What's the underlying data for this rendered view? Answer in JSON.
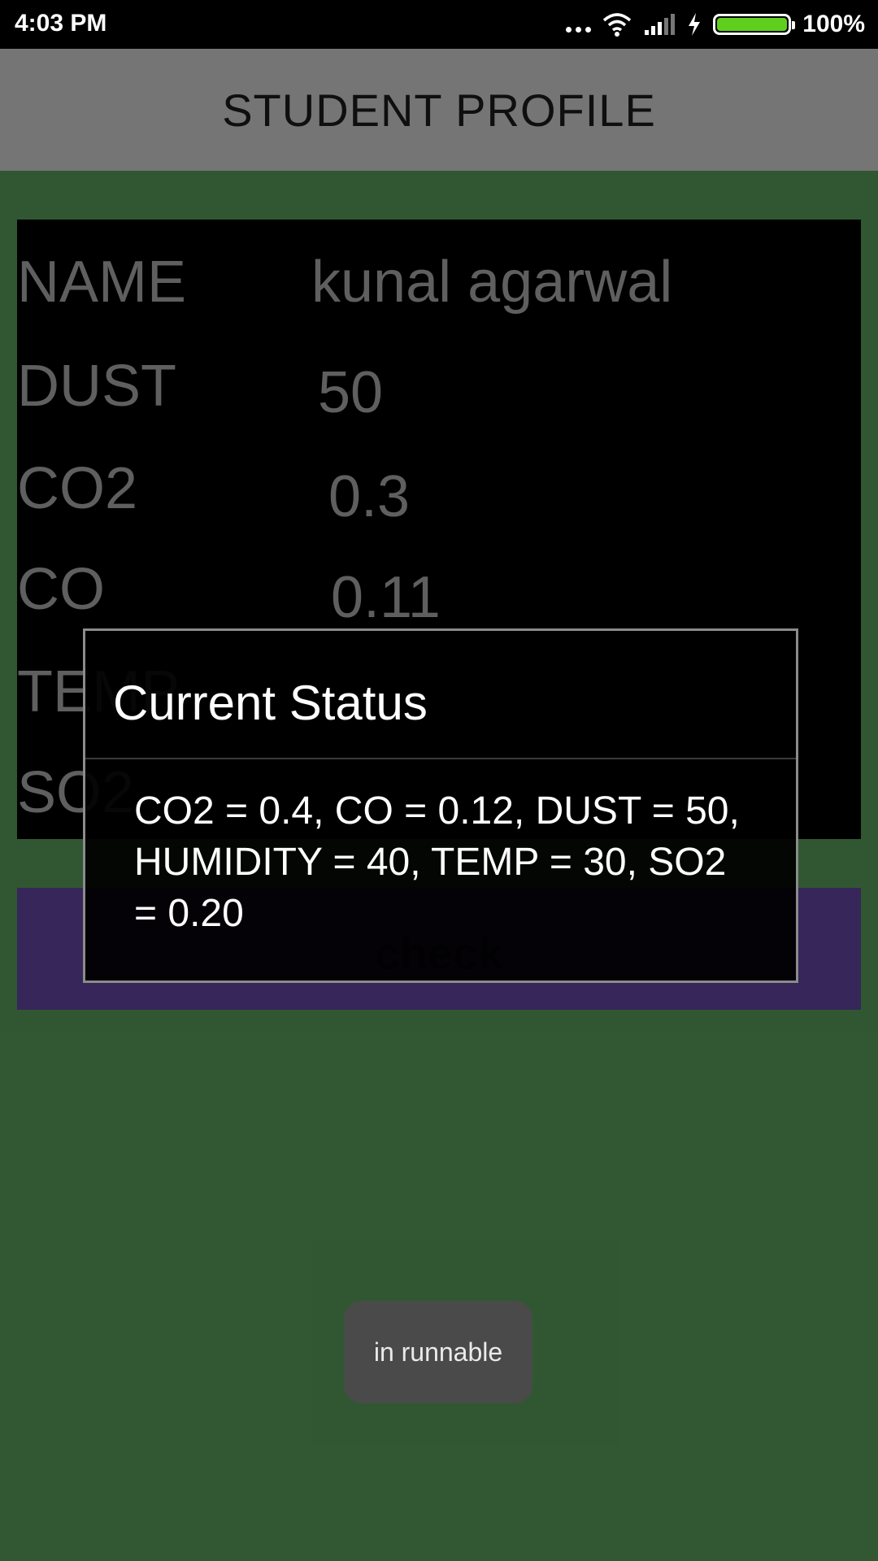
{
  "status_bar": {
    "time": "4:03 PM",
    "battery_percent": "100%",
    "icons": [
      "more-dots-icon",
      "wifi-icon",
      "signal-icon",
      "charging-icon",
      "battery-icon"
    ]
  },
  "app_bar": {
    "title": "STUDENT PROFILE"
  },
  "profile": {
    "rows": [
      {
        "label": "NAME",
        "value": "kunal agarwal"
      },
      {
        "label": "DUST",
        "value": "50"
      },
      {
        "label": "CO2",
        "value": "0.3"
      },
      {
        "label": "CO",
        "value": "0.11"
      },
      {
        "label": "TEMP",
        "value": ""
      },
      {
        "label": "SO2",
        "value": ""
      }
    ]
  },
  "check_button": {
    "label": "check"
  },
  "dialog": {
    "title": "Current Status",
    "message": "CO2 = 0.4, CO = 0.12, DUST = 50, HUMIDITY = 40, TEMP = 30, SO2 = 0.20"
  },
  "toast": {
    "text": "in runnable"
  },
  "colors": {
    "background": "#365f37",
    "app_bar": "#7f7f7f",
    "table_bg": "#000000",
    "button": "#3b2a61",
    "battery_fill": "#5fcf1d"
  }
}
